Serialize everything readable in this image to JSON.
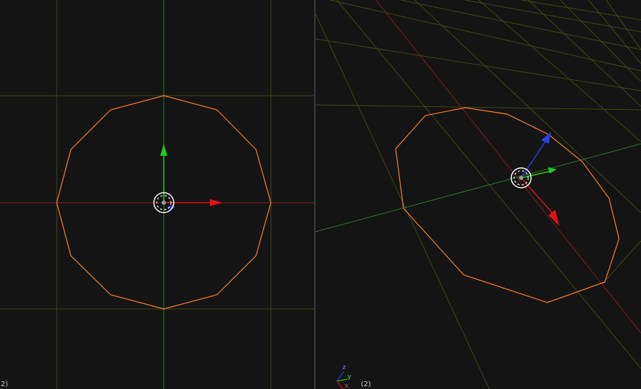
{
  "colors": {
    "background": "#141414",
    "grid": "#3e4a16",
    "axis_x": "#7a1f1f",
    "axis_y": "#2f7a2f",
    "mesh": "#ff7f2a",
    "gizmo_x": "#e31212",
    "gizmo_y": "#22c922",
    "gizmo_z": "#2a3fe0",
    "text": "#cfcfcf"
  },
  "viewports": {
    "left": {
      "view": "top-orthographic",
      "frame_label": "2)"
    },
    "right": {
      "view": "perspective",
      "frame_label": "(2)",
      "axes": {
        "z_label": "z",
        "y_label": "y",
        "x_label": "x"
      }
    }
  },
  "icons": {
    "pivot": "target-reticle-icon",
    "gizmo_x": "arrow-right-icon",
    "gizmo_y": "arrow-up-icon",
    "gizmo_z": "arrow-diagonal-icon"
  }
}
